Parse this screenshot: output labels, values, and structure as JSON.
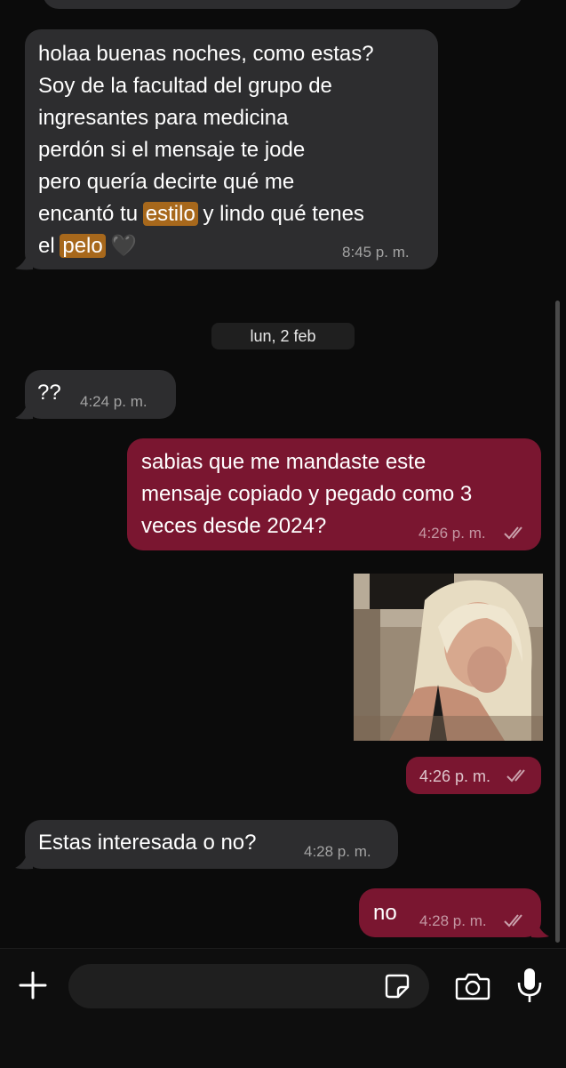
{
  "messages": {
    "m0_partial": {
      "direction": "incoming"
    },
    "m1": {
      "direction": "incoming",
      "lines": {
        "l1": "holaa buenas noches, como estas?",
        "l2": "Soy de la facultad del grupo de",
        "l3": "ingresantes para medicina",
        "l4": "perdón si el mensaje te jode",
        "l5": "pero quería decirte qué me",
        "l6a": "encantó tu ",
        "l6b": "estilo",
        "l6c": " y lindo qué tenes",
        "l7a": "el ",
        "l7b": "pelo",
        "l7c": " 🖤"
      },
      "time": "8:45 p. m."
    },
    "date_separator": "lun, 2 feb",
    "m2": {
      "direction": "incoming",
      "text": "??",
      "time": "4:24 p. m."
    },
    "m3": {
      "direction": "outgoing",
      "lines": {
        "l1": "sabias que me mandaste este",
        "l2": "mensaje copiado y pegado como 3",
        "l3": "veces desde 2024?"
      },
      "time": "4:26 p. m.",
      "status": "read"
    },
    "m4": {
      "direction": "outgoing",
      "type": "image",
      "time": "4:26 p. m.",
      "status": "read"
    },
    "m5": {
      "direction": "incoming",
      "text": "Estas interesada o no?",
      "time": "4:28 p. m."
    },
    "m6": {
      "direction": "outgoing",
      "text": "no",
      "time": "4:28 p. m.",
      "status": "read"
    }
  },
  "composer": {
    "plus_icon": "plus-icon",
    "sticker_icon": "sticker-icon",
    "camera_icon": "camera-icon",
    "mic_icon": "microphone-icon"
  },
  "colors": {
    "incoming_bubble": "#2d2d2f",
    "outgoing_bubble": "#7a1630",
    "highlight": "#a7681c",
    "background": "#0b0b0b"
  }
}
